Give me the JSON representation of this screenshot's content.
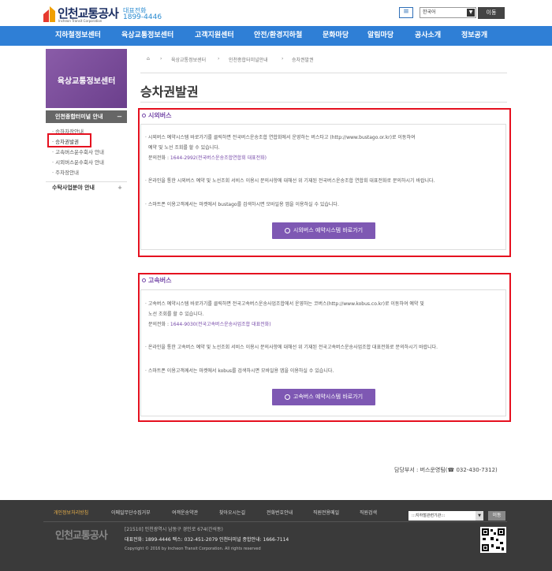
{
  "header": {
    "logo": "인천교통공사",
    "logo_sub": "Incheon Transit Corporation",
    "rep_label": "대표전화",
    "rep_number": "1899-4446",
    "menu_icon": "≡",
    "lang_value": "한국어",
    "go_label": "이동"
  },
  "gnb": [
    "지하철정보센터",
    "육상교통정보센터",
    "고객지원센터",
    "안전/환경지하철",
    "문화마당",
    "알림마당",
    "공사소개",
    "정보공개"
  ],
  "sidebar": {
    "banner": "육상교통정보센터",
    "head": "인천종합터미널 안내",
    "head_toggle": "－",
    "items": [
      "· 승하차장안내",
      "· 승차권발권",
      "· 고속버스운수회사 안내",
      "· 시외버스운수회사 안내",
      "· 주차장안내"
    ],
    "item2": "수탁사업분야 안내",
    "item2_toggle": "+"
  },
  "breadcrumb": [
    "⌂",
    "›",
    "육상교통정보센터",
    "›",
    "인천종합터미널안내",
    "›",
    "승차권발권"
  ],
  "page_title": "승차권발권",
  "sections": {
    "intercity": {
      "title": "시외버스",
      "l1": "· 시외버스 예약시스템 바로가기를 클릭하면 전국버스운송조합 연합회에서 운영하는 버스타고 (http://www.bustago.or.kr)로 이동하여",
      "l2": "예약 및 노선 조회를 할 수 있습니다.",
      "l3_label": "문의전화 : ",
      "l3_value": "1644-2992(전국버스운송조합연합회 대표전화)",
      "l4": "· 온라인을 통한 시외버스 예약 및 노선조회 서비스 이용시 문의사항에 대해선 위 기재된 전국버스운송조합 연합회 대표전화로 문의하시기 바랍니다.",
      "l5": "· 스마트폰 이용고객께서는 마켓에서 bustago를 검색하시면 모바일용 앱을 이용하실 수 있습니다.",
      "button": "시외버스 예약시스템 바로가기"
    },
    "express": {
      "title": "고속버스",
      "l1": "· 고속버스 예약시스템 바로가기를 클릭하면 전국고속버스운송사업조합에서 운영하는 코버스(http://www.kobus.co.kr)로 이동하여 예약 및",
      "l2": "노선 조회를 할 수 있습니다.",
      "l3_label": "문의전화 : ",
      "l3_value": "1644-9030(전국고속버스운송사업조합 대표전화)",
      "l4": "· 온라인을 통한 고속버스 예약 및 노선조회 서비스 이용시 문의사항에 대해선 위 기재된 전국고속버스운송사업조합 대표전화로 문의하시기 바랍니다.",
      "l5": "· 스마트폰 이용고객께서는 마켓에서 kobus를 검색하시면 모바일용 앱을 이용하실 수 있습니다.",
      "button": "고속버스 예약시스템 바로가기"
    }
  },
  "dept": "담당부서 : 버스운영팀(☎ 032-430-7312)",
  "footer": {
    "links": [
      "개인정보처리방침",
      "이메일무단수집거부",
      "여객운송약관",
      "찾아오시는길",
      "전화번호안내",
      "직원전용메일",
      "직원검색"
    ],
    "select": ":::지하철관련기관:::",
    "go": "이동",
    "logo": "인천교통공사",
    "addr": "[21510] 인천광역시 남동구 경인로 674(간석동)",
    "phone": "대표전화: 1899-4446    팩스: 032-451-2079    인천터미널 종합안내: 1666-7114",
    "copy": "Copyright © 2016 by Incheon Transit Corporation.  All rights reserved"
  },
  "colors": {
    "accent": "#2f7fd6",
    "purple": "#7548a8",
    "highlight": "#e5101f"
  }
}
